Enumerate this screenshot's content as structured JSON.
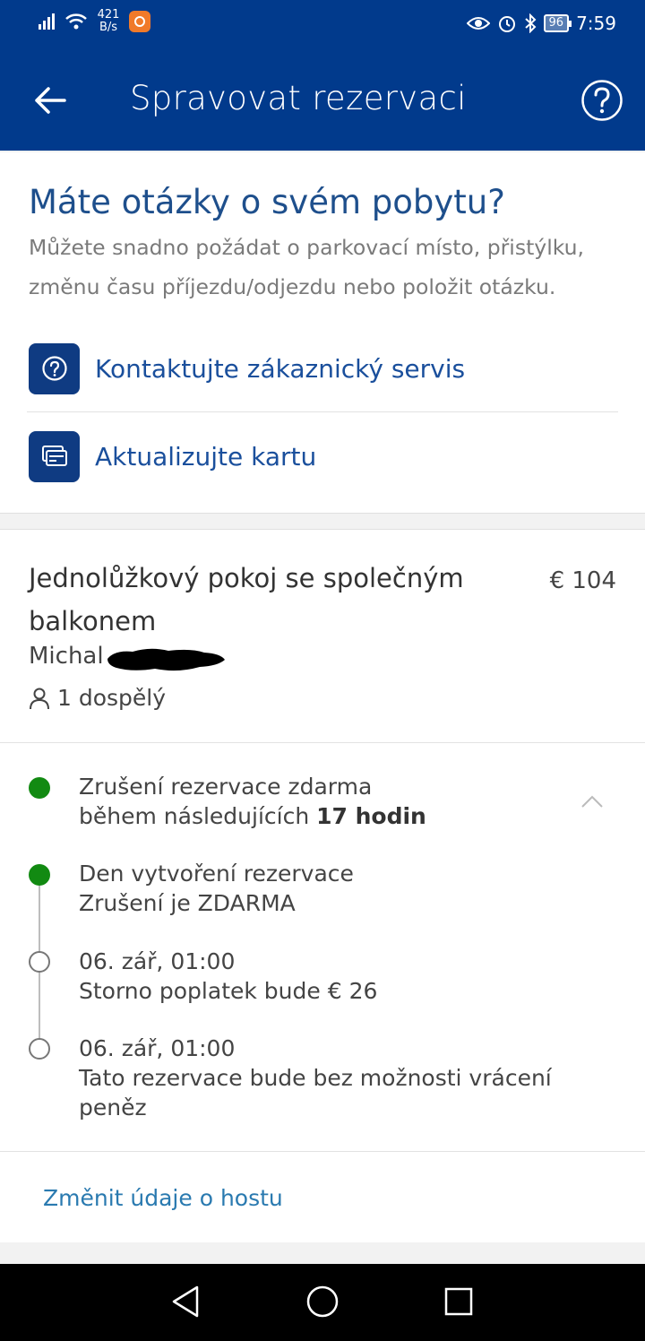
{
  "status_bar": {
    "net_speed_value": "421",
    "net_speed_unit": "B/s",
    "battery": "96",
    "time": "7:59"
  },
  "header": {
    "title": "Spravovat rezervaci"
  },
  "questions": {
    "title": "Máte otázky o svém pobytu?",
    "description": "Můžete snadno požádat o parkovací místo, přistýlku, změnu času příjezdu/odjezdu nebo položit otázku.",
    "contact_label": "Kontaktujte zákaznický servis",
    "update_card_label": "Aktualizujte kartu"
  },
  "booking": {
    "room_name": "Jednolůžkový pokoj se společným balkonem",
    "price": "€ 104",
    "guest_name": "Michal",
    "occupancy": "1 dospělý"
  },
  "cancellation": {
    "summary_line1": "Zrušení rezervace zdarma",
    "summary_line2_prefix": "během následujících ",
    "summary_line2_bold": "17 hodin",
    "steps": [
      {
        "line1": "Den vytvoření rezervace",
        "line2": "Zrušení je ZDARMA"
      },
      {
        "line1": "06. zář, 01:00",
        "line2": "Storno poplatek bude € 26"
      },
      {
        "line1": "06. zář, 01:00",
        "line2": "Tato rezervace bude bez možnosti vrácení peněz"
      }
    ]
  },
  "footer_link": "Změnit údaje o hostu",
  "colors": {
    "brand_blue": "#013a8c",
    "link_blue": "#1a4f9c",
    "free_green": "#128a12"
  }
}
